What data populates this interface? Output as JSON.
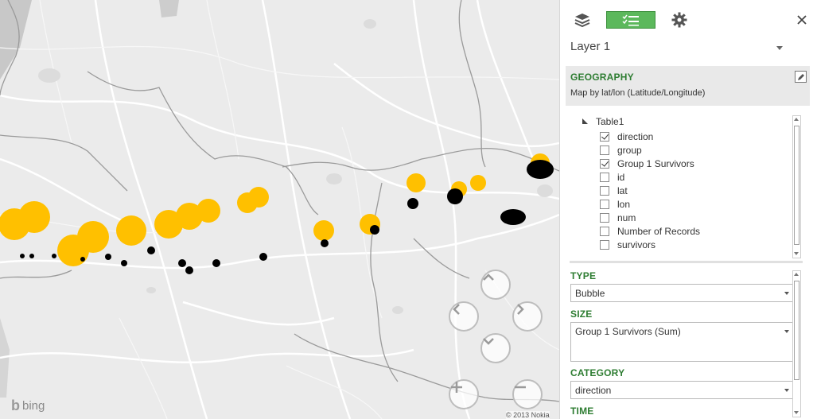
{
  "map": {
    "attribution": "bing",
    "copyright": "© 2013 Nokia",
    "bubble_colors": {
      "size_series": "#ffc000",
      "category_series": "#000000"
    },
    "nav_icons": [
      "pan-up-icon",
      "pan-left-icon",
      "pan-right-icon",
      "pan-down-icon",
      "zoom-in-icon",
      "zoom-out-icon"
    ]
  },
  "panel": {
    "layer_name": "Layer 1",
    "geography": {
      "title": "GEOGRAPHY",
      "description": "Map by lat/lon (Latitude/Longitude)"
    },
    "table": {
      "name": "Table1",
      "fields": [
        {
          "label": "direction",
          "checked": true
        },
        {
          "label": "group",
          "checked": false
        },
        {
          "label": "Group 1 Survivors",
          "checked": true
        },
        {
          "label": "id",
          "checked": false
        },
        {
          "label": "lat",
          "checked": false
        },
        {
          "label": "lon",
          "checked": false
        },
        {
          "label": "num",
          "checked": false
        },
        {
          "label": "Number of Records",
          "checked": false
        },
        {
          "label": "survivors",
          "checked": false
        }
      ]
    },
    "type": {
      "title": "TYPE",
      "value": "Bubble"
    },
    "size": {
      "title": "SIZE",
      "value": "Group 1 Survivors (Sum)"
    },
    "category": {
      "title": "CATEGORY",
      "value": "direction"
    },
    "time": {
      "title": "TIME"
    },
    "accent_color": "#2e7d32",
    "active_tab_color": "#5cb85c"
  }
}
